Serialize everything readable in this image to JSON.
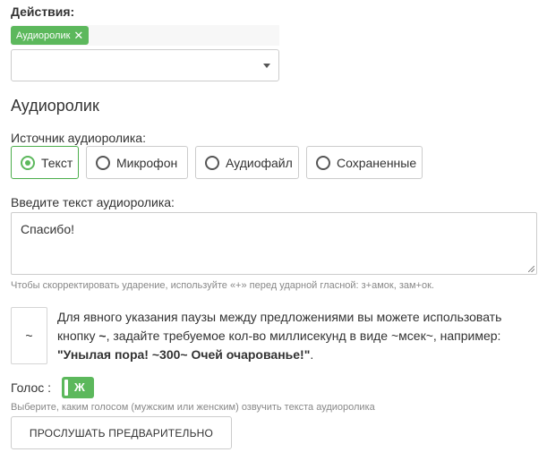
{
  "actions": {
    "label": "Действия:",
    "tag_label": "Аудиоролик",
    "tag_remove_icon": "close-icon",
    "select_value": ""
  },
  "section": {
    "title": "Аудиоролик"
  },
  "source": {
    "label": "Источник аудиоролика:",
    "options": [
      "Текст",
      "Микрофон",
      "Аудиофайл",
      "Сохраненные"
    ],
    "selected": "Текст"
  },
  "text_input": {
    "label": "Введите текст аудиоролика:",
    "value": "Спасибо!",
    "hint": "Чтобы скорректировать ударение, используйте «+» перед ударной гласной: з+амок, зам+ок."
  },
  "pause": {
    "button_label": "~",
    "text_1": "Для явного указания паузы между предложениями вы можете использовать кнопку ",
    "text_tilde": "~",
    "text_2": ", задайте требуемое кол-во миллисекунд в виде ~мсек~, например:",
    "example": "\"Унылая пора! ~300~ Очей очарованье!\"",
    "example_suffix": "."
  },
  "voice": {
    "label": "Голос :",
    "toggle_value": "Ж",
    "hint": "Выберите, каким голосом (мужским или женским) озвучить текста аудиоролика"
  },
  "preview_button": {
    "label": "ПРОСЛУШАТЬ ПРЕДВАРИТЕЛЬНО"
  },
  "colors": {
    "accent": "#5cb85c",
    "text": "#333333",
    "hint": "#888888",
    "border": "#cccccc"
  }
}
